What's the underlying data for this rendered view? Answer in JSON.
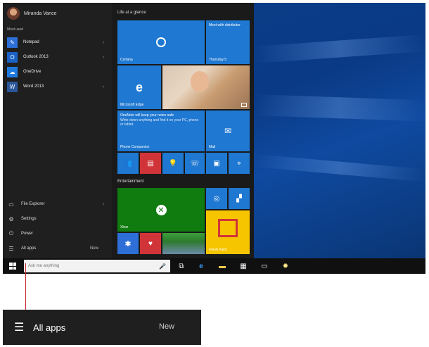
{
  "user": {
    "name": "Miranda Vance"
  },
  "left": {
    "section_label": "Most used",
    "apps": [
      {
        "label": "Notepad",
        "icon": "notepad-icon",
        "color": "#2d6fd6",
        "chevron": "›"
      },
      {
        "label": "Outlook 2013",
        "icon": "outlook-icon",
        "color": "#1b63c6",
        "chevron": "›"
      },
      {
        "label": "OneDrive",
        "icon": "onedrive-icon",
        "color": "#1f7be0",
        "chevron": ""
      },
      {
        "label": "Word 2013",
        "icon": "word-icon",
        "color": "#2b579a",
        "chevron": "›"
      }
    ],
    "system": [
      {
        "label": "File Explorer",
        "icon": "folder-icon"
      },
      {
        "label": "Settings",
        "icon": "gear-icon"
      },
      {
        "label": "Power",
        "icon": "power-icon"
      },
      {
        "label": "All apps",
        "icon": "list-icon",
        "badge": "New"
      }
    ]
  },
  "tiles": {
    "group1_title": "Life at a glance",
    "group2_title": "Entertainment",
    "cortana_label": "Cortana",
    "calendar_text": "Meet with distributor",
    "calendar_date": "Thursday 5",
    "edge_label": "Microsoft Edge",
    "onenote_title": "OneNote will keep your notes safe",
    "onenote_body": "Write down anything and find it on your PC, phone or tablet.",
    "phone_label": "Phone Companion",
    "mail_label": "Mail",
    "xbox_label": "Xbox",
    "fresh_label": "Fresh Paint"
  },
  "taskbar": {
    "search_placeholder": "Ask me anything"
  },
  "callout": {
    "label": "All apps",
    "badge": "New"
  },
  "colors": {
    "tile_blue": "#1f78d1",
    "tile_green": "#107c10",
    "tile_red": "#d13438",
    "fresh_paint": "#f7c400",
    "callout_line": "#c8242e"
  }
}
